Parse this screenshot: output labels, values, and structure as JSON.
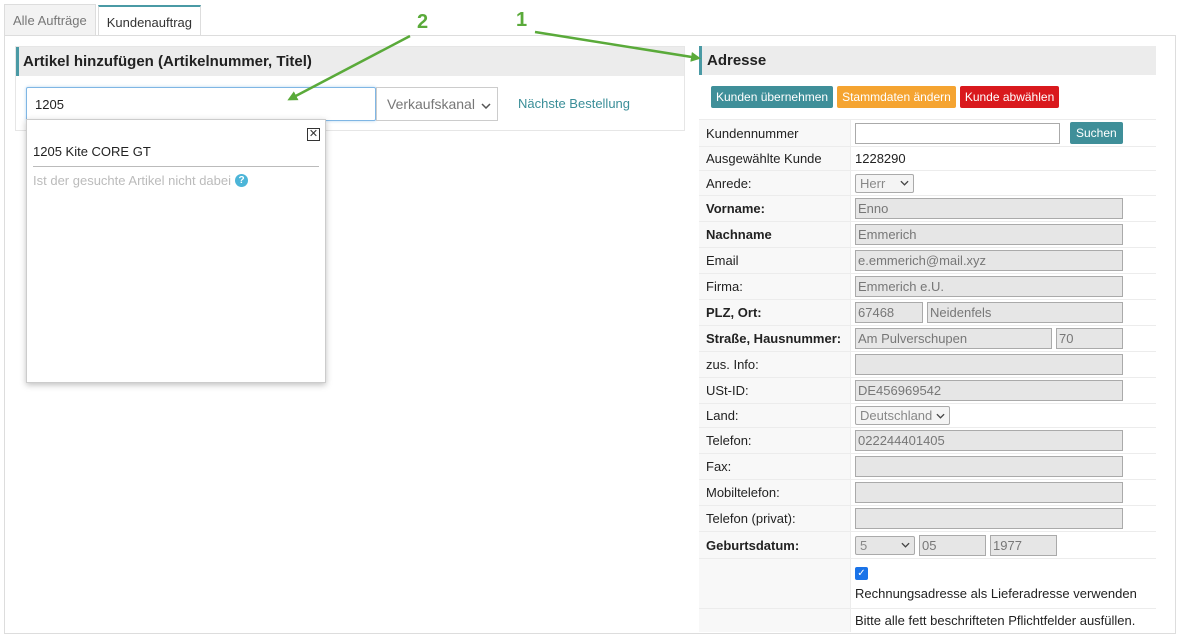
{
  "tabs": [
    {
      "label": "Alle Aufträge",
      "active": false
    },
    {
      "label": "Kundenauftrag",
      "active": true
    }
  ],
  "article_panel": {
    "title": "Artikel hinzufügen (Artikelnummer, Titel)",
    "search_value": "1205",
    "kanal_placeholder": "Verkaufskanal",
    "next_link": "Nächste Bestellung",
    "dropdown": {
      "close_symbol": "✕",
      "result": "1205 Kite CORE GT",
      "hint": "Ist der gesuchte Artikel nicht dabei",
      "help_symbol": "?"
    }
  },
  "address_panel": {
    "title": "Adresse",
    "buttons": {
      "take_customer": "Kunden übernehmen",
      "change_master": "Stammdaten ändern",
      "deselect": "Kunde abwählen"
    },
    "search_label": "Suchen",
    "fields": {
      "kundennummer": {
        "label": "Kundennummer",
        "value": ""
      },
      "ausgewaehlt": {
        "label": "Ausgewählte Kunde",
        "value": "1228290"
      },
      "anrede": {
        "label": "Anrede:",
        "value": "Herr"
      },
      "vorname": {
        "label": "Vorname:",
        "value": "Enno"
      },
      "nachname": {
        "label": "Nachname",
        "value": "Emmerich"
      },
      "email": {
        "label": "Email",
        "value": "e.emmerich@mail.xyz"
      },
      "firma": {
        "label": "Firma:",
        "value": "Emmerich e.U."
      },
      "plz_ort": {
        "label": "PLZ, Ort:",
        "plz": "67468",
        "ort": "Neidenfels"
      },
      "strasse": {
        "label": "Straße, Hausnummer:",
        "strasse": "Am Pulverschupen",
        "nr": "70"
      },
      "zus_info": {
        "label": "zus. Info:",
        "value": ""
      },
      "ust_id": {
        "label": "USt-ID:",
        "value": "DE456969542"
      },
      "land": {
        "label": "Land:",
        "value": "Deutschland"
      },
      "telefon": {
        "label": "Telefon:",
        "value": "022244401405"
      },
      "fax": {
        "label": "Fax:",
        "value": ""
      },
      "mobil": {
        "label": "Mobiltelefon:",
        "value": ""
      },
      "tel_privat": {
        "label": "Telefon (privat):",
        "value": ""
      },
      "geburtsdatum": {
        "label": "Geburtsdatum:",
        "day": "5",
        "month": "05",
        "year": "1977"
      }
    },
    "checkbox_label": "Rechnungsadresse als Lieferadresse verwenden",
    "required_note": "Bitte alle fett beschrifteten Pflichtfelder ausfüllen."
  },
  "annotations": {
    "one": "1",
    "two": "2",
    "color": "#5aaa3a"
  }
}
